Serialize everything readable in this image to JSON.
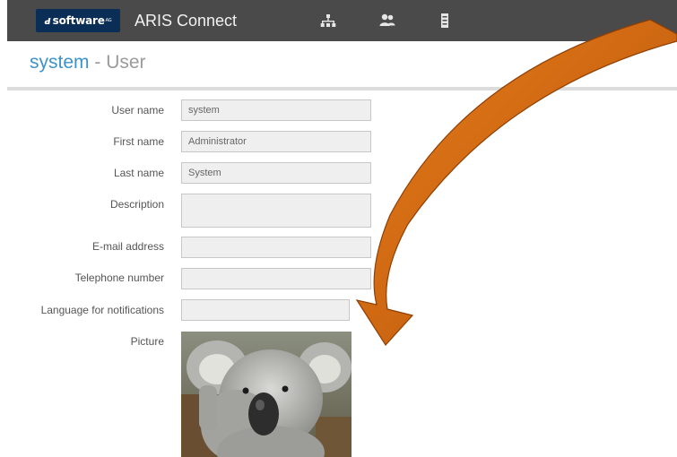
{
  "header": {
    "logo_text": "software",
    "logo_mark": "AG",
    "app_title": "ARIS Connect",
    "nav_icons": [
      "hierarchy-icon",
      "users-icon",
      "document-icon"
    ],
    "bar_color": "#4a4a4a"
  },
  "page": {
    "object_name": "system",
    "separator": " - ",
    "object_type": "User",
    "title_color": "#3d93c8"
  },
  "form": {
    "user_name": {
      "label": "User name",
      "value": "system"
    },
    "first_name": {
      "label": "First name",
      "value": "Administrator"
    },
    "last_name": {
      "label": "Last name",
      "value": "System"
    },
    "description": {
      "label": "Description",
      "value": ""
    },
    "email": {
      "label": "E-mail address",
      "value": ""
    },
    "telephone": {
      "label": "Telephone number",
      "value": ""
    },
    "language": {
      "label": "Language for notifications",
      "value": ""
    },
    "picture": {
      "label": "Picture"
    }
  },
  "annotation": {
    "type": "curved-arrow",
    "color": "#d4690c"
  }
}
